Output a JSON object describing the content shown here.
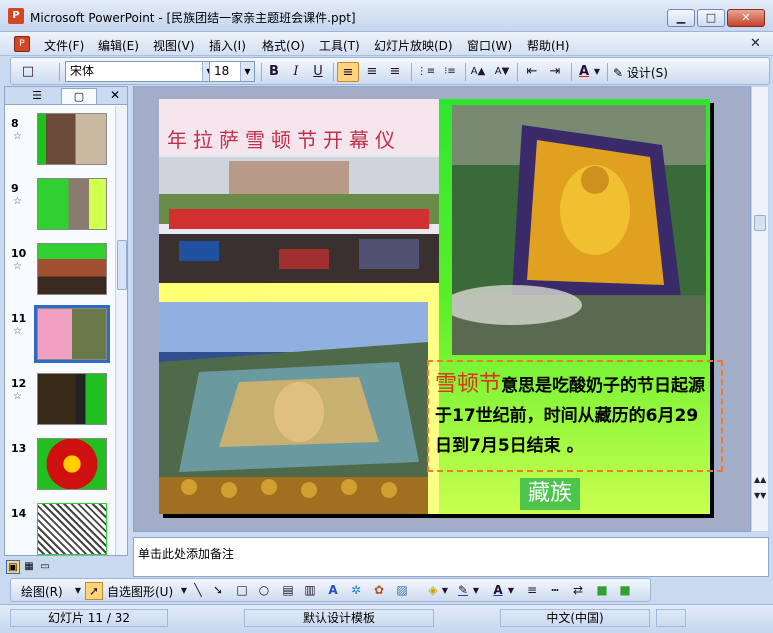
{
  "window": {
    "app_icon": "P",
    "title": "Microsoft PowerPoint - [民族团结一家亲主题班会课件.ppt]",
    "minimize": "▁",
    "maximize": "□",
    "close": "✕"
  },
  "menu": {
    "doc_icon": "P",
    "items": [
      "文件(F)",
      "编辑(E)",
      "视图(V)",
      "插入(I)",
      "格式(O)",
      "工具(T)",
      "幻灯片放映(D)",
      "窗口(W)",
      "帮助(H)"
    ],
    "close": "✕"
  },
  "toolbar": {
    "font_name": "宋体",
    "font_size": "18",
    "bold": "B",
    "italic": "I",
    "underline": "U",
    "align_left": "≡",
    "align_center": "≡",
    "align_right": "≡",
    "numbering": "⋮≡",
    "bullets": "⁝≡",
    "increase_font": "A▲",
    "decrease_font": "A▼",
    "decrease_indent": "⇤",
    "increase_indent": "⇥",
    "font_color": "A",
    "design_label": "设计(S)",
    "new_doc": "□"
  },
  "left_panel": {
    "tab_outline": "☰",
    "tab_slides": "▢",
    "close": "✕",
    "thumbnails": [
      {
        "number": "8",
        "star": "☆"
      },
      {
        "number": "9",
        "star": "☆"
      },
      {
        "number": "10",
        "star": "☆"
      },
      {
        "number": "11",
        "star": "☆"
      },
      {
        "number": "12",
        "star": "☆"
      },
      {
        "number": "13",
        "star": ""
      },
      {
        "number": "14",
        "star": ""
      }
    ]
  },
  "slide": {
    "lead_text": "雪顿节",
    "body_text": "意思是吃酸奶子的节日起源于17世纪前，时间从藏历的6月29日到7月5日结束 。",
    "tag": "藏族",
    "banner_text": "年拉萨雪顿节开幕仪"
  },
  "notes": {
    "placeholder": "单击此处添加备注"
  },
  "view_buttons": [
    "▣",
    "▦",
    "▭"
  ],
  "drawbar": {
    "draw_label": "绘图(R)",
    "autoshapes_label": "自选图形(U)",
    "select_icon": "➚",
    "line": "╲",
    "arrow": "➘",
    "rect": "□",
    "oval": "○",
    "textbox": "▤",
    "vtextbox": "▥",
    "wordart": "A",
    "diagram": "✲",
    "clipart": "✿",
    "picture": "▨",
    "fill_color": "◈",
    "line_color": "✎",
    "font_color": "A",
    "line_style": "≡",
    "dash_style": "┅",
    "arrow_style": "⇄",
    "shadow": "■",
    "threed": "■"
  },
  "status": {
    "slide_info": "幻灯片 11 / 32",
    "template": "默认设计模板",
    "language": "中文(中国)"
  },
  "colors": {
    "accent": "#316ac5",
    "lead_text": "#e0301e",
    "textbox_border": "#f07a2a",
    "tag_bg": "#4dc44d"
  }
}
